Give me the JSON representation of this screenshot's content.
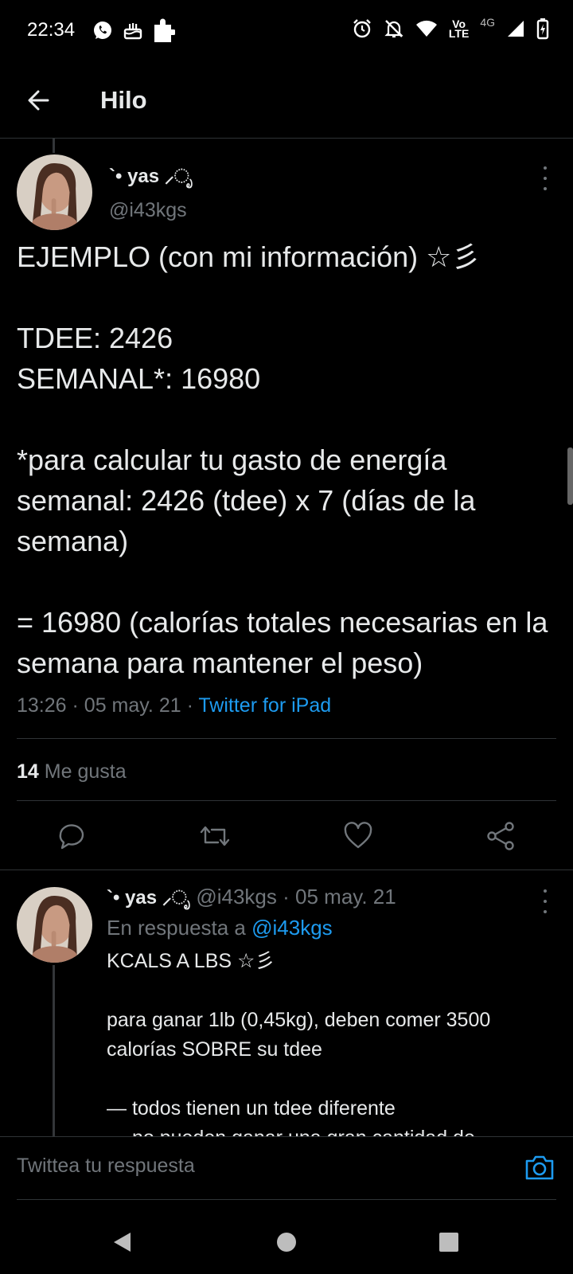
{
  "status_bar": {
    "time": "22:34",
    "network_label_top": "Vo",
    "network_label_bottom": "LTE",
    "network_type": "4G",
    "icons": [
      "whatsapp-icon",
      "cake-icon",
      "puzzle-icon",
      "alarm-icon",
      "notifications-off-icon",
      "wifi-icon",
      "signal-icon",
      "battery-charging-icon"
    ]
  },
  "header": {
    "title": "Hilo",
    "back_icon": "arrow-left-icon"
  },
  "main_tweet": {
    "display_name": "`• yas ⸝ೃ",
    "handle": "@i43kgs",
    "body": [
      "EJEMPLO (con mi información) ☆彡",
      "",
      "TDEE: 2426",
      "SEMANAL*: 16980",
      "",
      "*para calcular tu gasto de energía semanal: 2426 (tdee) x 7 (días de la semana)",
      "",
      "= 16980 (calorías totales necesarias en la semana para mantener el peso)"
    ],
    "time": "13:26",
    "date": "05 may. 21",
    "source": "Twitter for iPad",
    "like_count": "14",
    "like_label": "Me gusta",
    "actions": [
      "reply-icon",
      "retweet-icon",
      "like-icon",
      "share-icon"
    ]
  },
  "reply_tweet": {
    "display_name": "`• yas ⸝ೃ",
    "handle": "@i43kgs",
    "date": "05 may. 21",
    "replying_to_label": "En respuesta a",
    "replying_to_handle": "@i43kgs",
    "body": "KCALS A LBS ☆彡\n\npara ganar 1lb (0,45kg), deben comer 3500 calorías SOBRE su tdee\n\n— todos tienen un tdee diferente\n— no pueden ganar una gran cantidad de"
  },
  "compose": {
    "placeholder": "Twittea tu respuesta",
    "camera_icon": "camera-icon"
  },
  "navbar": {
    "buttons": [
      "back-triangle-icon",
      "home-circle-icon",
      "recents-square-icon"
    ]
  },
  "colors": {
    "background": "#000000",
    "text": "#e7e9ea",
    "secondary": "#71767b",
    "accent": "#1d9bf0",
    "divider": "#2f3336"
  }
}
